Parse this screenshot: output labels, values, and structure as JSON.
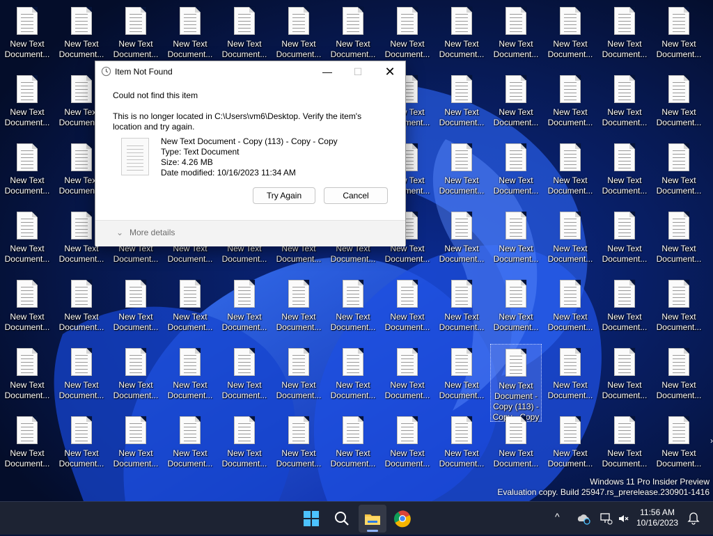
{
  "desktop": {
    "icon_label_line1": "New Text",
    "icon_label_line2": "Document...",
    "selected_label": [
      "New Text",
      "Document -",
      "Copy (113) -",
      "Copy - Copy"
    ]
  },
  "dialog": {
    "title": "Item Not Found",
    "heading": "Could not find this item",
    "message": "This is no longer located in C:\\Users\\vm6\\Desktop. Verify the item's location and try again.",
    "file": {
      "name": "New Text Document - Copy (113) - Copy - Copy",
      "type": "Type: Text Document",
      "size": "Size: 4.26 MB",
      "modified": "Date modified: 10/16/2023 11:34 AM"
    },
    "try_again": "Try Again",
    "cancel": "Cancel",
    "more_details": "More details",
    "minimize_glyph": "—",
    "maximize_glyph": "☐",
    "close_glyph": "✕"
  },
  "watermark": {
    "line1": "Windows 11 Pro Insider Preview",
    "line2": "Evaluation copy. Build 25947.rs_prerelease.230901-1416"
  },
  "taskbar": {
    "items": [
      "start-icon",
      "search-icon",
      "file-explorer-icon",
      "chrome-icon"
    ],
    "tray_chevron": "^",
    "time": "11:56 AM",
    "date": "10/16/2023"
  },
  "colors": {
    "wallpaper_dark": "#06143a",
    "wallpaper_blue": "#1d4fe0",
    "taskbar": "#1d2333",
    "accent": "#0078d4"
  }
}
